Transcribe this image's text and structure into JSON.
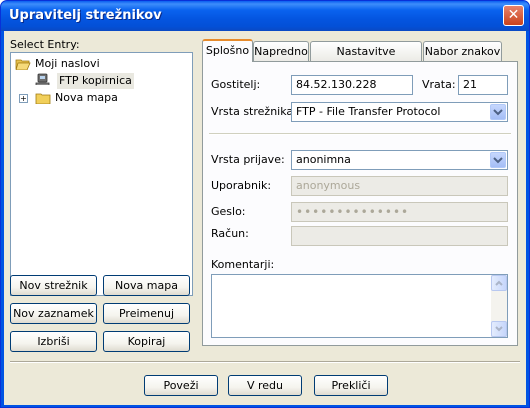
{
  "window": {
    "title": "Upravitelj strežnikov",
    "close_glyph": "✕"
  },
  "sidebar": {
    "select_label": "Select Entry:",
    "tree": {
      "root": "Moji naslovi",
      "server": "FTP kopirnica",
      "folder": "Nova mapa",
      "expander": "+"
    },
    "buttons": {
      "new_server": "Nov strežnik",
      "new_folder": "Nova mapa",
      "new_bookmark": "Nov zaznamek",
      "rename": "Preimenuj",
      "delete": "Izbriši",
      "copy": "Kopiraj"
    }
  },
  "tabs": [
    "Splošno",
    "Napredno",
    "Nastavitve prenosov",
    "Nabor znakov"
  ],
  "general": {
    "host_label": "Gostitelj:",
    "host_value": "84.52.130.228",
    "port_label": "Vrata:",
    "port_value": "21",
    "server_type_label": "Vrsta strežnika:",
    "server_type_value": "FTP - File Transfer Protocol",
    "logon_type_label": "Vrsta prijave:",
    "logon_type_value": "anonimna",
    "user_label": "Uporabnik:",
    "user_value": "anonymous",
    "password_label": "Geslo:",
    "password_value": "••••••••••••••",
    "account_label": "Račun:",
    "account_value": "",
    "comments_label": "Komentarji:"
  },
  "footer": {
    "connect": "Poveži",
    "ok": "V redu",
    "cancel": "Prekliči"
  },
  "colors": {
    "titlebar": "#0054e3",
    "client_bg": "#ece9d8",
    "input_border": "#7f9db9"
  }
}
